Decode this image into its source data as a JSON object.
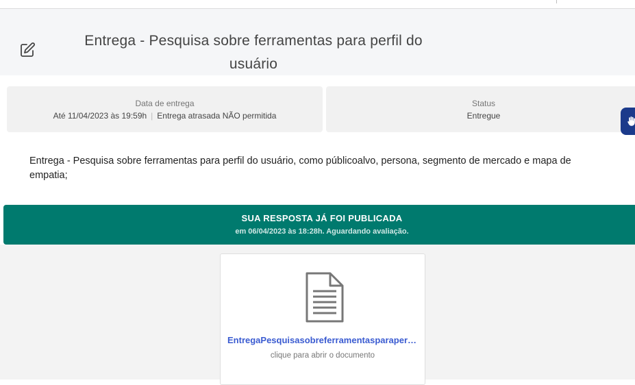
{
  "header": {
    "title": "Entrega - Pesquisa sobre ferramentas para perfil do usuário",
    "edit_icon": "edit-icon"
  },
  "info": {
    "due": {
      "label": "Data de entrega",
      "date": "Até 11/04/2023 às 19:59h",
      "late_policy": "Entrega atrasada NÃO permitida"
    },
    "status": {
      "label": "Status",
      "value": "Entregue"
    }
  },
  "description": "Entrega - Pesquisa sobre ferramentas para perfil do usuário, como públicoalvo, persona, segmento de mercado e mapa de empatia;",
  "banner": {
    "title": "SUA RESPOSTA JÁ FOI PUBLICADA",
    "subtitle": "em 06/04/2023 às 18:28h. Aguardando avaliação.",
    "color": "#007a6e"
  },
  "document": {
    "name": "EntregaPesquisasobreferramentasparaperfildousuario",
    "hint": "clique para abrir o documento",
    "icon": "document-icon",
    "link_color": "#3a5bd1"
  },
  "accessibility": {
    "icon": "hand-sign-icon",
    "color": "#1b3a8b"
  }
}
